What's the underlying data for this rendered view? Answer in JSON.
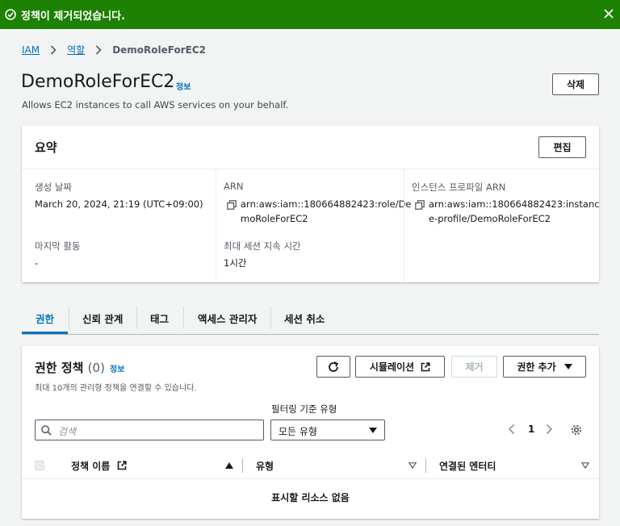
{
  "flash": {
    "message": "정책이 제거되었습니다."
  },
  "breadcrumb": {
    "items": [
      "IAM",
      "역할"
    ],
    "current": "DemoRoleForEC2"
  },
  "header": {
    "title": "DemoRoleForEC2",
    "info": "정보",
    "description": "Allows EC2 instances to call AWS services on your behalf.",
    "delete_label": "삭제"
  },
  "summary": {
    "title": "요약",
    "edit_label": "편집",
    "created_label": "생성 날짜",
    "created_value": "March 20, 2024, 21:19 (UTC+09:00)",
    "last_activity_label": "마지막 활동",
    "last_activity_value": "-",
    "arn_label": "ARN",
    "arn_line1": "arn:aws:iam::180664882423:role/De",
    "arn_line2": "moRoleForEC2",
    "max_session_label": "최대 세션 지속 시간",
    "max_session_value": "1시간",
    "profile_label": "인스턴스 프로파일 ARN",
    "profile_line1": "arn:aws:iam::180664882423:instanc",
    "profile_line2": "e-profile/DemoRoleForEC2"
  },
  "tabs": [
    "권한",
    "신뢰 관계",
    "태그",
    "액세스 관리자",
    "세션 취소"
  ],
  "policies": {
    "title": "권한 정책",
    "count": "(0)",
    "info": "정보",
    "description": "최대 10개의 관리형 정책을 연결할 수 있습니다.",
    "simulate_label": "시뮬레이션",
    "remove_label": "제거",
    "add_label": "권한 추가",
    "filter_label": "필터링 기준 유형",
    "search_placeholder": "검색",
    "type_value": "모든 유형",
    "page": "1",
    "col_name": "정책 이름",
    "col_type": "유형",
    "col_entities": "연결된 엔터티",
    "empty": "표시할 리소스 없음"
  },
  "colors": {
    "success": "#1d8102",
    "link": "#0073bb",
    "text": "#16191f"
  }
}
